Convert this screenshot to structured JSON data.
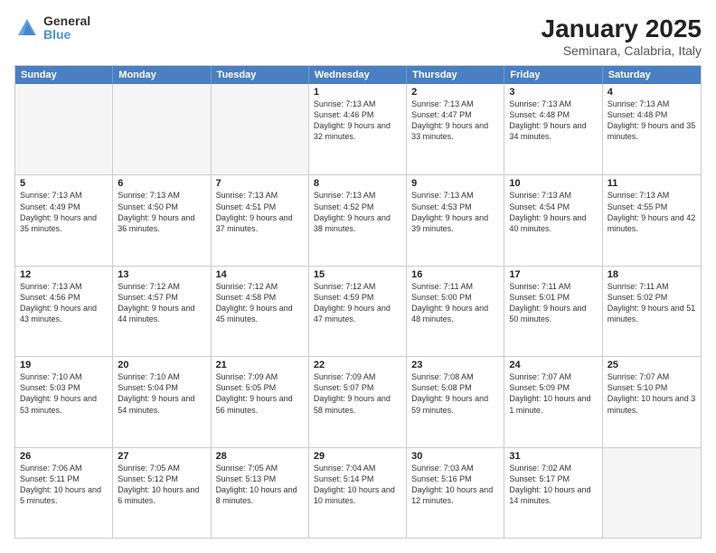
{
  "logo": {
    "general": "General",
    "blue": "Blue"
  },
  "title": "January 2025",
  "location": "Seminara, Calabria, Italy",
  "header_days": [
    "Sunday",
    "Monday",
    "Tuesday",
    "Wednesday",
    "Thursday",
    "Friday",
    "Saturday"
  ],
  "weeks": [
    [
      {
        "day": "",
        "info": "",
        "empty": true
      },
      {
        "day": "",
        "info": "",
        "empty": true
      },
      {
        "day": "",
        "info": "",
        "empty": true
      },
      {
        "day": "1",
        "info": "Sunrise: 7:13 AM\nSunset: 4:46 PM\nDaylight: 9 hours and 32 minutes.",
        "empty": false
      },
      {
        "day": "2",
        "info": "Sunrise: 7:13 AM\nSunset: 4:47 PM\nDaylight: 9 hours and 33 minutes.",
        "empty": false
      },
      {
        "day": "3",
        "info": "Sunrise: 7:13 AM\nSunset: 4:48 PM\nDaylight: 9 hours and 34 minutes.",
        "empty": false
      },
      {
        "day": "4",
        "info": "Sunrise: 7:13 AM\nSunset: 4:48 PM\nDaylight: 9 hours and 35 minutes.",
        "empty": false
      }
    ],
    [
      {
        "day": "5",
        "info": "Sunrise: 7:13 AM\nSunset: 4:49 PM\nDaylight: 9 hours and 35 minutes.",
        "empty": false
      },
      {
        "day": "6",
        "info": "Sunrise: 7:13 AM\nSunset: 4:50 PM\nDaylight: 9 hours and 36 minutes.",
        "empty": false
      },
      {
        "day": "7",
        "info": "Sunrise: 7:13 AM\nSunset: 4:51 PM\nDaylight: 9 hours and 37 minutes.",
        "empty": false
      },
      {
        "day": "8",
        "info": "Sunrise: 7:13 AM\nSunset: 4:52 PM\nDaylight: 9 hours and 38 minutes.",
        "empty": false
      },
      {
        "day": "9",
        "info": "Sunrise: 7:13 AM\nSunset: 4:53 PM\nDaylight: 9 hours and 39 minutes.",
        "empty": false
      },
      {
        "day": "10",
        "info": "Sunrise: 7:13 AM\nSunset: 4:54 PM\nDaylight: 9 hours and 40 minutes.",
        "empty": false
      },
      {
        "day": "11",
        "info": "Sunrise: 7:13 AM\nSunset: 4:55 PM\nDaylight: 9 hours and 42 minutes.",
        "empty": false
      }
    ],
    [
      {
        "day": "12",
        "info": "Sunrise: 7:13 AM\nSunset: 4:56 PM\nDaylight: 9 hours and 43 minutes.",
        "empty": false
      },
      {
        "day": "13",
        "info": "Sunrise: 7:12 AM\nSunset: 4:57 PM\nDaylight: 9 hours and 44 minutes.",
        "empty": false
      },
      {
        "day": "14",
        "info": "Sunrise: 7:12 AM\nSunset: 4:58 PM\nDaylight: 9 hours and 45 minutes.",
        "empty": false
      },
      {
        "day": "15",
        "info": "Sunrise: 7:12 AM\nSunset: 4:59 PM\nDaylight: 9 hours and 47 minutes.",
        "empty": false
      },
      {
        "day": "16",
        "info": "Sunrise: 7:11 AM\nSunset: 5:00 PM\nDaylight: 9 hours and 48 minutes.",
        "empty": false
      },
      {
        "day": "17",
        "info": "Sunrise: 7:11 AM\nSunset: 5:01 PM\nDaylight: 9 hours and 50 minutes.",
        "empty": false
      },
      {
        "day": "18",
        "info": "Sunrise: 7:11 AM\nSunset: 5:02 PM\nDaylight: 9 hours and 51 minutes.",
        "empty": false
      }
    ],
    [
      {
        "day": "19",
        "info": "Sunrise: 7:10 AM\nSunset: 5:03 PM\nDaylight: 9 hours and 53 minutes.",
        "empty": false
      },
      {
        "day": "20",
        "info": "Sunrise: 7:10 AM\nSunset: 5:04 PM\nDaylight: 9 hours and 54 minutes.",
        "empty": false
      },
      {
        "day": "21",
        "info": "Sunrise: 7:09 AM\nSunset: 5:05 PM\nDaylight: 9 hours and 56 minutes.",
        "empty": false
      },
      {
        "day": "22",
        "info": "Sunrise: 7:09 AM\nSunset: 5:07 PM\nDaylight: 9 hours and 58 minutes.",
        "empty": false
      },
      {
        "day": "23",
        "info": "Sunrise: 7:08 AM\nSunset: 5:08 PM\nDaylight: 9 hours and 59 minutes.",
        "empty": false
      },
      {
        "day": "24",
        "info": "Sunrise: 7:07 AM\nSunset: 5:09 PM\nDaylight: 10 hours and 1 minute.",
        "empty": false
      },
      {
        "day": "25",
        "info": "Sunrise: 7:07 AM\nSunset: 5:10 PM\nDaylight: 10 hours and 3 minutes.",
        "empty": false
      }
    ],
    [
      {
        "day": "26",
        "info": "Sunrise: 7:06 AM\nSunset: 5:11 PM\nDaylight: 10 hours and 5 minutes.",
        "empty": false
      },
      {
        "day": "27",
        "info": "Sunrise: 7:05 AM\nSunset: 5:12 PM\nDaylight: 10 hours and 6 minutes.",
        "empty": false
      },
      {
        "day": "28",
        "info": "Sunrise: 7:05 AM\nSunset: 5:13 PM\nDaylight: 10 hours and 8 minutes.",
        "empty": false
      },
      {
        "day": "29",
        "info": "Sunrise: 7:04 AM\nSunset: 5:14 PM\nDaylight: 10 hours and 10 minutes.",
        "empty": false
      },
      {
        "day": "30",
        "info": "Sunrise: 7:03 AM\nSunset: 5:16 PM\nDaylight: 10 hours and 12 minutes.",
        "empty": false
      },
      {
        "day": "31",
        "info": "Sunrise: 7:02 AM\nSunset: 5:17 PM\nDaylight: 10 hours and 14 minutes.",
        "empty": false
      },
      {
        "day": "",
        "info": "",
        "empty": true
      }
    ]
  ]
}
